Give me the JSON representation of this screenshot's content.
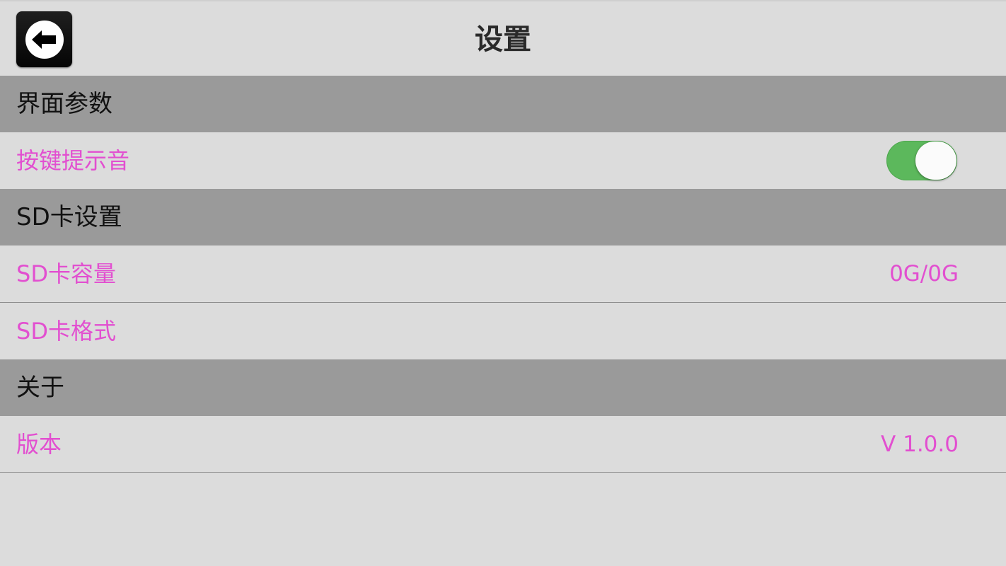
{
  "header": {
    "title": "设置",
    "back_icon": "back-arrow-icon"
  },
  "sections": [
    {
      "title": "界面参数",
      "rows": [
        {
          "label": "按键提示音",
          "control": "toggle",
          "toggle_on": true,
          "toggle_color": "#5cb85c"
        }
      ]
    },
    {
      "title": "SD卡设置",
      "rows": [
        {
          "label": "SD卡容量",
          "value": "0G/0G"
        },
        {
          "label": "SD卡格式",
          "value": ""
        }
      ]
    },
    {
      "title": "关于",
      "rows": [
        {
          "label": "版本",
          "value": "V 1.0.0"
        }
      ]
    }
  ],
  "colors": {
    "background": "#dcdcdc",
    "section_header_bg": "#9a9a9a",
    "row_text": "#e24fd0",
    "header_text": "#2a2a2a"
  }
}
